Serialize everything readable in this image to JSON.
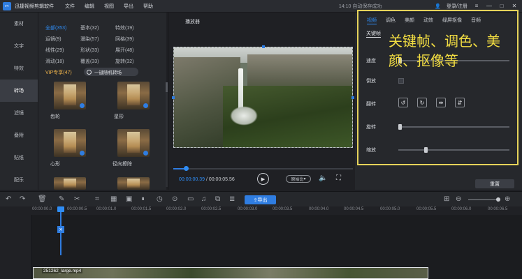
{
  "app": {
    "name": "迅捷视频剪辑软件",
    "menus": [
      "文件",
      "编辑",
      "视图",
      "导出",
      "帮助"
    ],
    "autosave": "14:10 自动保存成功",
    "login": "登录/注册"
  },
  "leftnav": [
    "素材",
    "文字",
    "特效",
    "转场",
    "滤镜",
    "叠附",
    "贴纸",
    "配乐"
  ],
  "library": {
    "categories": [
      [
        "全部(353)",
        "基本(32)",
        "特效(19)"
      ],
      [
        "运镜(9)",
        "漫染(57)",
        "网格(39)"
      ],
      [
        "线性(29)",
        "形状(33)",
        "展开(48)"
      ],
      [
        "滑动(18)",
        "覆盖(33)",
        "旋转(32)"
      ]
    ],
    "vip": "VIP专享(47)",
    "random_btn": "一键随机转场",
    "items": [
      "齿轮",
      "星形",
      "心形",
      "径向擦除"
    ]
  },
  "player": {
    "title": "播放器",
    "current": "00:00:00.39",
    "total": "/ 00:00:05.56",
    "fit": "原始比"
  },
  "props": {
    "tabs": [
      "视频",
      "调色",
      "美颜",
      "动效",
      "绿屏抠像",
      "音频"
    ],
    "subtab": "关键帧",
    "callout": "关键帧、调色、美颜、抠像等",
    "labels": {
      "speed": "速度",
      "reverse": "倒放",
      "flip": "翻转",
      "rotate": "旋转",
      "scale": "缩放"
    },
    "reset": "重置"
  },
  "toolbar": {
    "export": "导出"
  },
  "ruler": [
    "00:00:00.0",
    "00:00:00.5",
    "00:00:01.0",
    "00:00:01.5",
    "00:00:02.0",
    "00:00:02.5",
    "00:00:03.0",
    "00:00:03.5",
    "00:00:04.0",
    "00:00:04.5",
    "00:00:05.0",
    "00:00:05.5",
    "00:00:06.0",
    "00:00:06.5"
  ],
  "clip": {
    "name": "251262_large.mp4"
  }
}
